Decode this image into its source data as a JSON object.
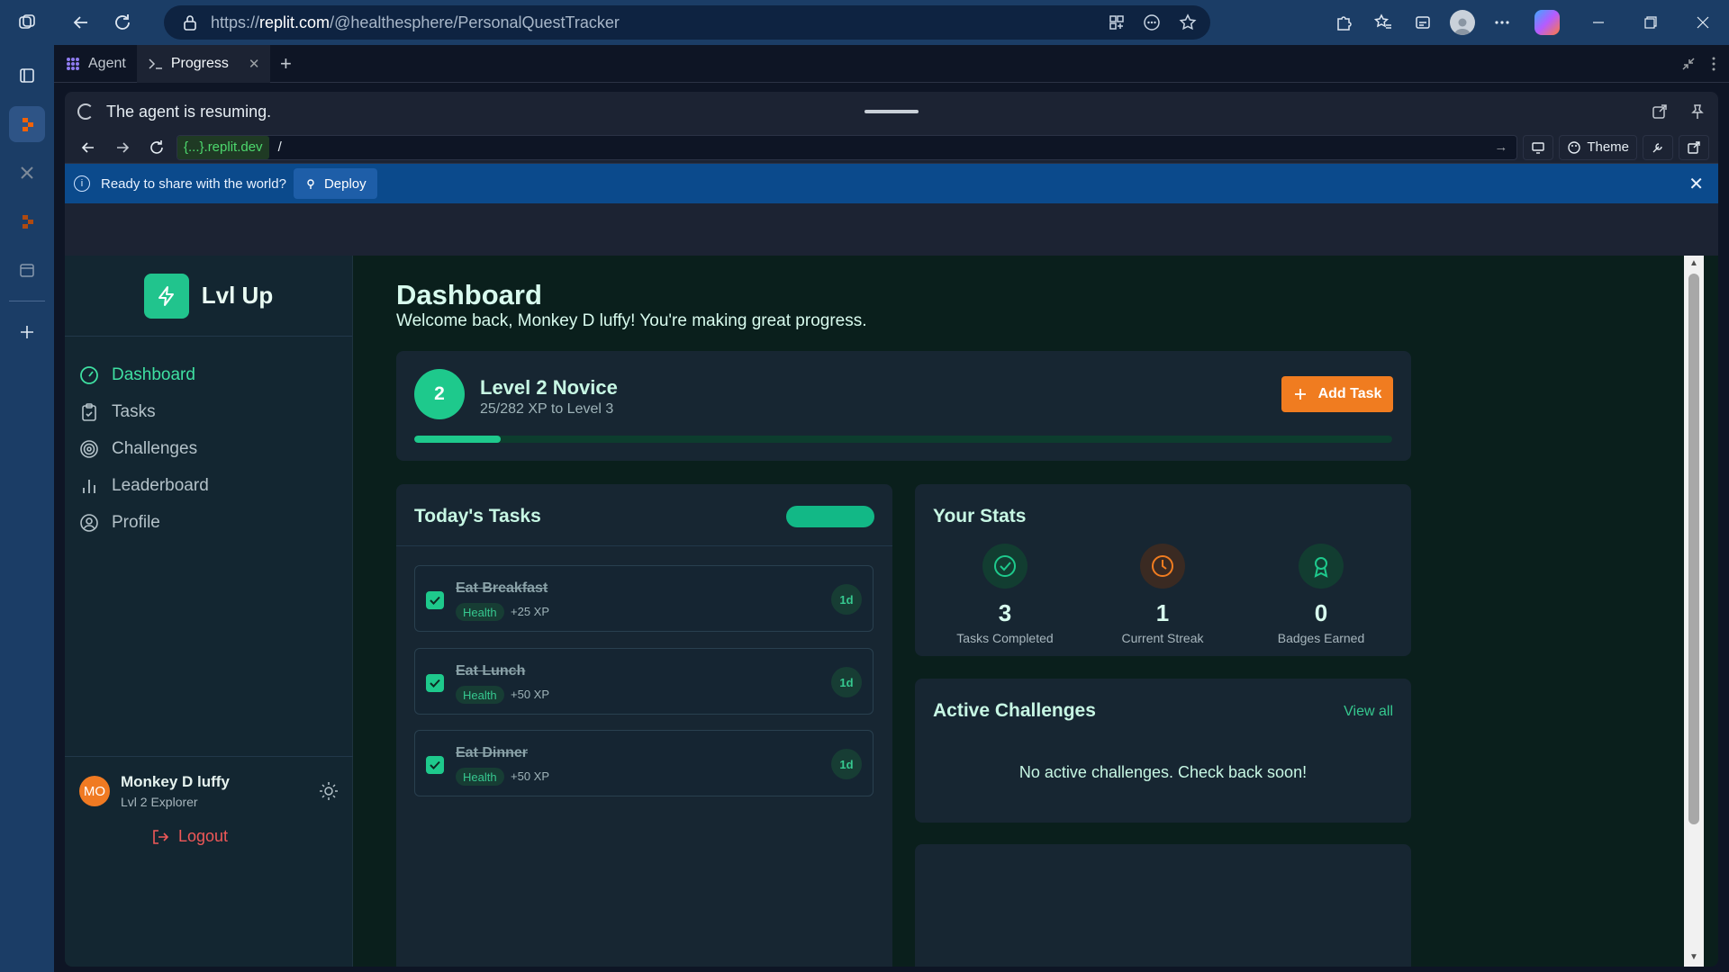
{
  "browser": {
    "url_prefix": "https://",
    "url_host": "replit.com",
    "url_path": "/@healthesphere/PersonalQuestTracker"
  },
  "replit": {
    "tabs": [
      {
        "label": "Agent"
      },
      {
        "label": "Progress"
      }
    ],
    "status": "The agent is resuming.",
    "webview": {
      "host": "{...}.replit.dev",
      "path": "/",
      "theme_label": "Theme"
    },
    "banner": {
      "text": "Ready to share with the world?",
      "deploy_label": "Deploy"
    }
  },
  "app": {
    "brand": "Lvl Up",
    "nav": [
      {
        "label": "Dashboard",
        "active": true
      },
      {
        "label": "Tasks"
      },
      {
        "label": "Challenges"
      },
      {
        "label": "Leaderboard"
      },
      {
        "label": "Profile"
      }
    ],
    "user": {
      "initials": "MO",
      "name": "Monkey D luffy",
      "level": "Lvl 2 Explorer",
      "logout_label": "Logout"
    },
    "dashboard": {
      "title": "Dashboard",
      "subtitle": "Welcome back, Monkey D luffy! You're making great progress.",
      "level_number": "2",
      "level_title": "Level 2 Novice",
      "xp_text": "25/282 XP to Level 3",
      "xp_progress": 0.0887,
      "add_task_label": "Add Task"
    },
    "tasks": {
      "title": "Today's Tasks",
      "items": [
        {
          "name": "Eat Breakfast",
          "category": "Health",
          "xp": "+25 XP",
          "freq": "1d",
          "done": true
        },
        {
          "name": "Eat Lunch",
          "category": "Health",
          "xp": "+50 XP",
          "freq": "1d",
          "done": true
        },
        {
          "name": "Eat Dinner",
          "category": "Health",
          "xp": "+50 XP",
          "freq": "1d",
          "done": true
        }
      ]
    },
    "stats": {
      "title": "Your Stats",
      "items": [
        {
          "value": "3",
          "label": "Tasks Completed",
          "icon": "check-circle-icon",
          "color": "#1ec98c"
        },
        {
          "value": "1",
          "label": "Current Streak",
          "icon": "clock-icon",
          "color": "#f07c20"
        },
        {
          "value": "0",
          "label": "Badges Earned",
          "icon": "award-icon",
          "color": "#1ec98c"
        }
      ]
    },
    "challenges": {
      "title": "Active Challenges",
      "view_all_label": "View all",
      "empty_text": "No active challenges. Check back soon!"
    },
    "colors": {
      "accent_green": "#1ec98c",
      "accent_orange": "#f07c20",
      "logout_red": "#f05858",
      "banner_blue": "#0b4a8c"
    }
  }
}
